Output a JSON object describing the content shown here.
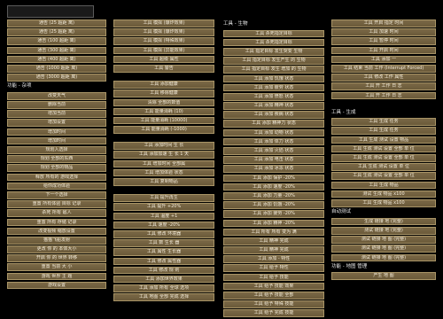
{
  "search": {
    "value": ""
  },
  "col1": [
    {
      "t": "b",
      "l": "通告 (25 超距 离)"
    },
    {
      "t": "b",
      "l": "通告 (25 超距 离)"
    },
    {
      "t": "b",
      "l": "通告 (100 超距 离)"
    },
    {
      "t": "b",
      "l": "通告 (300 超距 离)"
    },
    {
      "t": "b",
      "l": "通告 (400 超距 离)"
    },
    {
      "t": "b",
      "l": "通告 (1000 超距 离)"
    },
    {
      "t": "b",
      "l": "通告 (3000 超距 离)"
    },
    {
      "t": "h",
      "l": "功能 - 杂项"
    },
    {
      "t": "b",
      "l": "改变天气"
    },
    {
      "t": "b",
      "l": "删除当前"
    },
    {
      "t": "b",
      "l": "增加当前"
    },
    {
      "t": "b",
      "l": "增加设置"
    },
    {
      "t": "b",
      "l": "增加时间"
    },
    {
      "t": "b",
      "l": "增加时间"
    },
    {
      "t": "b",
      "l": "规划入选择"
    },
    {
      "t": "b",
      "l": "规划 全部的东西"
    },
    {
      "t": "b",
      "l": "规划 全部的物品"
    },
    {
      "t": "b",
      "l": "释放 所有的 游戏选择"
    },
    {
      "t": "b",
      "l": "给你成功体验"
    },
    {
      "t": "b",
      "l": "下一个选择"
    },
    {
      "t": "b",
      "l": "重置 所有体验 目标 记录"
    },
    {
      "t": "b",
      "l": "杀死 所有 敌人"
    },
    {
      "t": "b",
      "l": "重置 所有 存储 记录"
    },
    {
      "t": "b",
      "l": "改变视频 缩放设置"
    },
    {
      "t": "b",
      "l": "猫猫飞船发射"
    },
    {
      "t": "b",
      "l": "更改 你 的 本体大小"
    },
    {
      "t": "b",
      "l": "开启 你 的 世界 转移"
    },
    {
      "t": "b",
      "l": "重置 当前 大 小"
    },
    {
      "t": "b",
      "l": "游戏 世界 主 题"
    },
    {
      "t": "b",
      "l": "游戏设置"
    }
  ],
  "col2": [
    {
      "t": "b",
      "l": "工具 模拟 (爆炸效果)"
    },
    {
      "t": "b",
      "l": "工具 模拟 (爆炸效果)"
    },
    {
      "t": "b",
      "l": "工具 模拟 (特殊效果)"
    },
    {
      "t": "b",
      "l": "工具 模拟 (异能效果)"
    },
    {
      "t": "b",
      "l": "工具 超级 属性"
    },
    {
      "t": "b",
      "l": "工具 警告"
    },
    {
      "t": "g",
      "l": ""
    },
    {
      "t": "b",
      "l": "工具 添加健康"
    },
    {
      "t": "b",
      "l": "工具 移除健康"
    },
    {
      "t": "b",
      "l": "清除 全部的数值"
    },
    {
      "t": "b",
      "l": "工具 能量消耗 (10)"
    },
    {
      "t": "b",
      "l": "工具 能量消耗 (10000)"
    },
    {
      "t": "b",
      "l": "工具 能量消耗 (-1000)"
    },
    {
      "t": "g",
      "l": ""
    },
    {
      "t": "b",
      "l": "工具 添加时间 生 长"
    },
    {
      "t": "b",
      "l": "工具 添加加速 生 长 1 天"
    },
    {
      "t": "b",
      "l": "工具 增加时间 全部属"
    },
    {
      "t": "b",
      "l": "工具 增加体验 状态"
    },
    {
      "t": "b",
      "l": "工具 复制物品"
    },
    {
      "t": "g",
      "l": ""
    },
    {
      "t": "b",
      "l": "工具 提升再生"
    },
    {
      "t": "b",
      "l": "工具 提升 +20%"
    },
    {
      "t": "b",
      "l": "工具 温度 +1"
    },
    {
      "t": "b",
      "l": "工具 速度 -20%"
    },
    {
      "t": "b",
      "l": "工具 修改 环境器"
    },
    {
      "t": "b",
      "l": "工具 数 生长 器"
    },
    {
      "t": "b",
      "l": "工具 属性 生长器"
    },
    {
      "t": "b",
      "l": "工具 修改 属性器"
    },
    {
      "t": "b",
      "l": "工具 修改 规 则"
    },
    {
      "t": "b",
      "l": "工具 添加世界效果"
    },
    {
      "t": "b",
      "l": "工具 添加 所有 全球 选项"
    },
    {
      "t": "b",
      "l": "工具 地图 全部 完成 选择"
    }
  ],
  "col3": [
    {
      "t": "h",
      "l": "工具 - 生物"
    },
    {
      "t": "b",
      "l": "工具 杀死指定目标"
    },
    {
      "t": "b",
      "l": "工具 杀死指定目标"
    },
    {
      "t": "b",
      "l": "工具 指定目标 发生突变 生物"
    },
    {
      "t": "b",
      "l": "工具 指定目标 发生产生 的 生物"
    },
    {
      "t": "b",
      "l": "工具 指定目标 发生 增加 的 生物"
    },
    {
      "t": "b",
      "l": "工具 添加 饥饿 状态"
    },
    {
      "t": "b",
      "l": "工具 添加 疲劳 状态"
    },
    {
      "t": "b",
      "l": "工具 添加 愤怒 状态"
    },
    {
      "t": "b",
      "l": "工具 添加 精神 状态"
    },
    {
      "t": "b",
      "l": "工具 添加 疾病 状态"
    },
    {
      "t": "b",
      "l": "工具 添加 精神力 状态"
    },
    {
      "t": "b",
      "l": "工具 添加 动物 状态"
    },
    {
      "t": "b",
      "l": "工具 添加 体力 状态"
    },
    {
      "t": "b",
      "l": "工具 添加 火焰 状态"
    },
    {
      "t": "b",
      "l": "工具 添加 电击 状态"
    },
    {
      "t": "b",
      "l": "工具 添加 冰冻 状态"
    },
    {
      "t": "b",
      "l": "工具 添加 保护 -20%"
    },
    {
      "t": "b",
      "l": "工具 添加 速度 -20%"
    },
    {
      "t": "b",
      "l": "工具 添加 力量 -20%"
    },
    {
      "t": "b",
      "l": "工具 添加 饥饿 -20%"
    },
    {
      "t": "b",
      "l": "工具 添加 疲劳 -20%"
    },
    {
      "t": "b",
      "l": "工具 添加 精神 -20%"
    },
    {
      "t": "b",
      "l": "工具 所有 所有 变为 满"
    },
    {
      "t": "b",
      "l": "工具 精神 完成"
    },
    {
      "t": "b",
      "l": "工具 精神 完成"
    },
    {
      "t": "b",
      "l": "工具 添加 - 特性"
    },
    {
      "t": "b",
      "l": "工具 给予 特性"
    },
    {
      "t": "b",
      "l": "工具 给予 技能"
    },
    {
      "t": "b",
      "l": "工具 给予 技能 效果"
    },
    {
      "t": "b",
      "l": "工具 给予 技能 全部"
    },
    {
      "t": "b",
      "l": "工具 给予 特殊 技能"
    },
    {
      "t": "b",
      "l": "工具 给予 完成 技能"
    }
  ],
  "col4": [
    {
      "t": "b",
      "l": "工具 开启 指定 时间"
    },
    {
      "t": "b",
      "l": "工具 加速 时间"
    },
    {
      "t": "b",
      "l": "工具 暂停 时间"
    },
    {
      "t": "b",
      "l": "工具 开启 时间"
    },
    {
      "t": "b",
      "l": "工具 添加 一"
    },
    {
      "t": "b",
      "l": "工具 结束 当前 工作 (Interrupt Forced)"
    },
    {
      "t": "b",
      "l": "工具 修改 工作 属性"
    },
    {
      "t": "b",
      "l": "工具 开 工作 日 志"
    },
    {
      "t": "b",
      "l": "工具 开 工作 日 志"
    },
    {
      "t": "g",
      "l": ""
    },
    {
      "t": "h",
      "l": "工具 - 生成"
    },
    {
      "t": "b",
      "l": "工具 生成 任务"
    },
    {
      "t": "b",
      "l": "工具 生成 任务"
    },
    {
      "t": "b",
      "l": "工具 生成 测试 设置 物品"
    },
    {
      "t": "b",
      "l": "工具 生成 测试 设置 全部 单 位"
    },
    {
      "t": "b",
      "l": "工具 生成 测试 设置 全部 单 位"
    },
    {
      "t": "b",
      "l": "工具 生成 测试 设置 单 位"
    },
    {
      "t": "b",
      "l": "工具 生成 测试 设置 全部 单 位"
    },
    {
      "t": "b",
      "l": "工具 生成 物品"
    },
    {
      "t": "b",
      "l": "测试 生成 物品 x100"
    },
    {
      "t": "b",
      "l": "工具 生成 物品 x100"
    },
    {
      "t": "h",
      "l": "自动测试"
    },
    {
      "t": "b",
      "l": "生成 链接 地 (完整)"
    },
    {
      "t": "b",
      "l": "测试 链接 地 (完整)"
    },
    {
      "t": "b",
      "l": "测试 链接 地 图 (完整)"
    },
    {
      "t": "b",
      "l": "测试 链接 地 图 (完整)"
    },
    {
      "t": "b",
      "l": "测试 链接 地 图 (完整)"
    },
    {
      "t": "h",
      "l": "功能 - 地图 管理"
    },
    {
      "t": "b",
      "l": "产生 地 图"
    }
  ]
}
